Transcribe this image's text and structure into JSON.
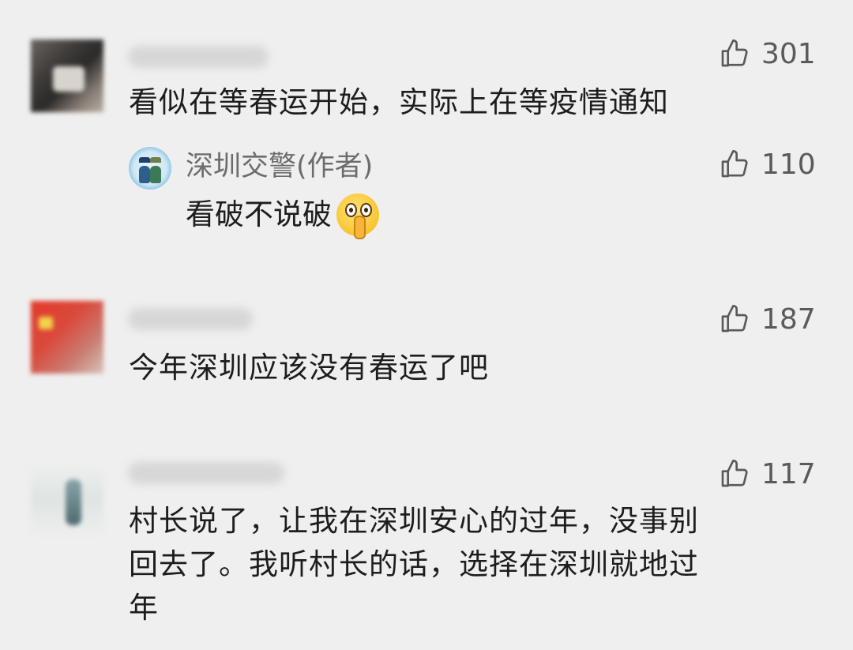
{
  "comments": [
    {
      "likes": "301",
      "text": "看似在等春运开始，实际上在等疫情通知",
      "reply": {
        "author": "深圳交警(作者)",
        "likes": "110",
        "text": "看破不说破",
        "emoji": "shushing-face-icon"
      }
    },
    {
      "likes": "187",
      "text": "今年深圳应该没有春运了吧"
    },
    {
      "likes": "117",
      "lines": [
        "村长说了，让我在深圳安心的过年，没事别",
        "回去了。我听村长的话，选择在深圳就地过",
        "年"
      ]
    }
  ],
  "icons": {
    "like": "thumbs-up-icon"
  },
  "colors": {
    "background": "#efefef",
    "text": "#1d1d1d",
    "muted": "#5a5a5a"
  }
}
